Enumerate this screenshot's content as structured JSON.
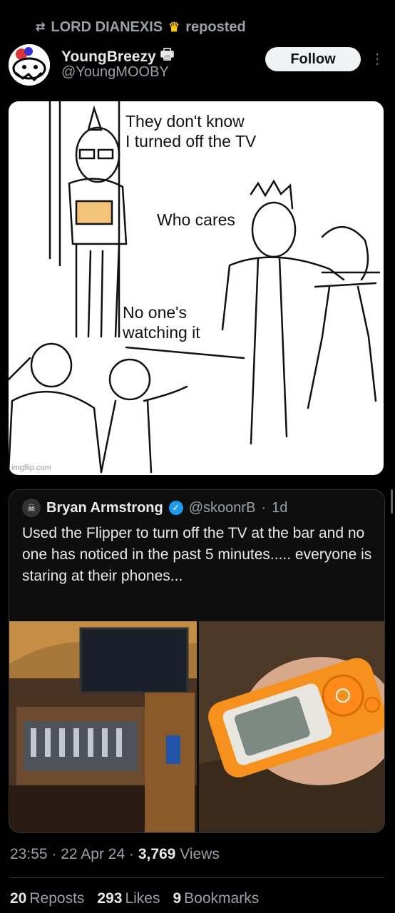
{
  "repost": {
    "user": "LORD DIANEXIS",
    "suffix": "reposted"
  },
  "author": {
    "name": "YoungBreezy",
    "handle": "@YoungMOOBY"
  },
  "follow_label": "Follow",
  "more_label": "⋮",
  "meme": {
    "text_1": "They don't know\nI turned off the TV",
    "text_2": "Who cares",
    "text_3": "No one's\nwatching it",
    "watermark": "imgflip.com"
  },
  "quote": {
    "name": "Bryan Armstrong",
    "handle": "@skoonrB",
    "time": "1d",
    "text": "Used the Flipper to turn off the TV at the bar and no one has noticed in the past 5 minutes..... everyone is staring at their phones..."
  },
  "footer": {
    "time": "23:55",
    "date": "22 Apr 24",
    "views_count": "3,769",
    "views_label": "Views",
    "reposts_count": "20",
    "reposts_label": "Reposts",
    "likes_count": "293",
    "likes_label": "Likes",
    "bookmarks_count": "9",
    "bookmarks_label": "Bookmarks"
  },
  "icons": {
    "repost": "repost-icon",
    "crown": "crown-icon",
    "printer": "printer-icon",
    "verified": "verified-badge-icon"
  },
  "colors": {
    "background": "#000000",
    "muted": "#9aa0a6",
    "verified": "#1d9bf0",
    "flipper_orange": "#f7911e"
  }
}
